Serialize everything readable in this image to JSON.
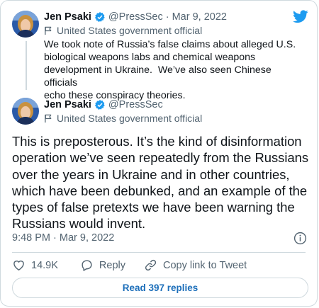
{
  "brand": {
    "accent": "#1d9bf0",
    "logo_icon": "twitter-bird-icon"
  },
  "quoted_tweet": {
    "author_name": "Jen Psaki",
    "handle_and_date": "@PressSec · Mar 9, 2022",
    "account_label": "United States government official",
    "label_icon": "flag-icon",
    "verified_icon": "verified-badge-icon",
    "text": "We took note of Russia’s false claims about alleged U.S.\nbiological weapons labs and chemical weapons\ndevelopment in Ukraine.  We’ve also seen Chinese officials\necho these conspiracy theories."
  },
  "main_tweet": {
    "author_name": "Jen Psaki",
    "handle": "@PressSec",
    "account_label": "United States government official",
    "text": "This is preposterous. It’s the kind of disinformation operation we’ve seen repeatedly from the Russians over the years in Ukraine and in other countries, which have been debunked, and an example of the types of false pretexts we have been warning the Russians would invent.",
    "timestamp": "9:48 PM · Mar 9, 2022",
    "info_icon": "info-icon"
  },
  "actions": {
    "likes_count": "14.9K",
    "reply_label": "Reply",
    "copy_link_label": "Copy link to Tweet"
  },
  "replies_button": {
    "label": "Read 397 replies"
  }
}
